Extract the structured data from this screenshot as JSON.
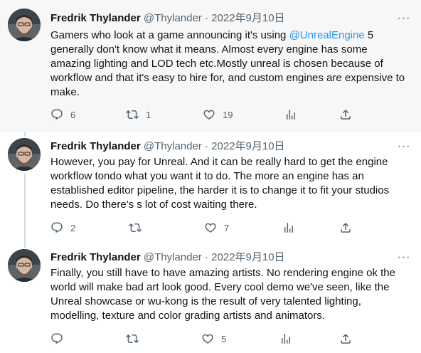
{
  "tweets": [
    {
      "name": "Fredrik Thylander",
      "handle": "@Thylander",
      "separator": "·",
      "date": "2022年9月10日",
      "more": "···",
      "text_before": "Gamers who look at a game announcing it's using ",
      "mention": "@UnrealEngine",
      "text_after": " 5 generally don't know what it means. Almost every engine has some amazing lighting and LOD tech etc.Mostly unreal is chosen because of workflow and that it's easy to hire for, and custom engines are expensive to make.",
      "replies": "6",
      "retweets": "1",
      "likes": "19"
    },
    {
      "name": "Fredrik Thylander",
      "handle": "@Thylander",
      "separator": "·",
      "date": "2022年9月10日",
      "more": "···",
      "text": "However, you pay for Unreal. And it can be really hard to get the engine workflow tondo what you want it to do. The more an engine has an established editor pipeline, the harder it is to change it to fit your studios needs. Do there's s lot of cost waiting there.",
      "replies": "2",
      "retweets": "",
      "likes": "7"
    },
    {
      "name": "Fredrik Thylander",
      "handle": "@Thylander",
      "separator": "·",
      "date": "2022年9月10日",
      "more": "···",
      "text": "Finally, you still have to have amazing artists. No rendering engine ok the world will make bad art look good. Every cool demo we've seen, like the Unreal showcase or wu-kong is the result of very talented lighting, modelling, texture and color grading artists and animators.",
      "replies": "",
      "retweets": "",
      "likes": "5"
    }
  ],
  "icons": {
    "reply": "reply-icon",
    "retweet": "retweet-icon",
    "like": "heart-icon",
    "views": "views-icon",
    "share": "share-icon"
  },
  "colors": {
    "mention": "#1d9bf0",
    "meta": "#536471",
    "highlight_bg": "#f7f7f7",
    "thread_line": "#cfd9de"
  }
}
